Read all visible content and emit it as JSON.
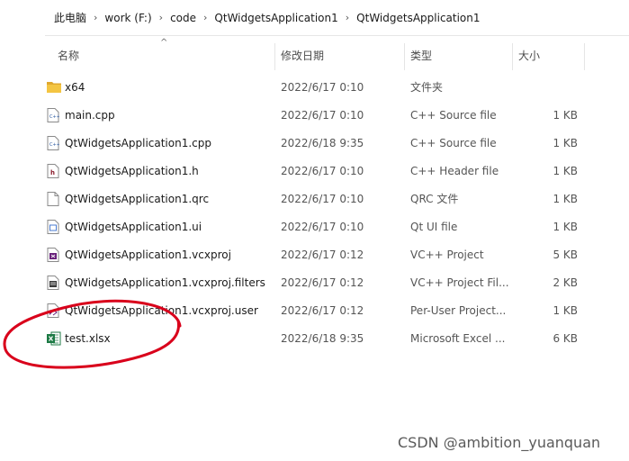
{
  "breadcrumb": [
    "此电脑",
    "work (F:)",
    "code",
    "QtWidgetsApplication1",
    "QtWidgetsApplication1"
  ],
  "columns": {
    "name": "名称",
    "date": "修改日期",
    "type": "类型",
    "size": "大小"
  },
  "files": [
    {
      "name": "x64",
      "date": "2022/6/17 0:10",
      "type": "文件夹",
      "size": "",
      "icon": "folder-icon"
    },
    {
      "name": "main.cpp",
      "date": "2022/6/17 0:10",
      "type": "C++ Source file",
      "size": "1 KB",
      "icon": "cpp-file-icon"
    },
    {
      "name": "QtWidgetsApplication1.cpp",
      "date": "2022/6/18 9:35",
      "type": "C++ Source file",
      "size": "1 KB",
      "icon": "cpp-file-icon"
    },
    {
      "name": "QtWidgetsApplication1.h",
      "date": "2022/6/17 0:10",
      "type": "C++ Header file",
      "size": "1 KB",
      "icon": "header-file-icon"
    },
    {
      "name": "QtWidgetsApplication1.qrc",
      "date": "2022/6/17 0:10",
      "type": "QRC 文件",
      "size": "1 KB",
      "icon": "blank-file-icon"
    },
    {
      "name": "QtWidgetsApplication1.ui",
      "date": "2022/6/17 0:10",
      "type": "Qt UI file",
      "size": "1 KB",
      "icon": "ui-file-icon"
    },
    {
      "name": "QtWidgetsApplication1.vcxproj",
      "date": "2022/6/17 0:12",
      "type": "VC++ Project",
      "size": "5 KB",
      "icon": "vcxproj-file-icon"
    },
    {
      "name": "QtWidgetsApplication1.vcxproj.filters",
      "date": "2022/6/17 0:12",
      "type": "VC++ Project Fil...",
      "size": "2 KB",
      "icon": "filters-file-icon"
    },
    {
      "name": "QtWidgetsApplication1.vcxproj.user",
      "date": "2022/6/17 0:12",
      "type": "Per-User Project...",
      "size": "1 KB",
      "icon": "user-file-icon"
    },
    {
      "name": "test.xlsx",
      "date": "2022/6/18 9:35",
      "type": "Microsoft Excel ...",
      "size": "6 KB",
      "icon": "excel-file-icon"
    }
  ],
  "watermark": "CSDN @ambition_yuanquan",
  "colors": {
    "folder": "#f4c542",
    "excel": "#1d7a45",
    "annotation": "#d9001b",
    "vs": "#68217a"
  }
}
